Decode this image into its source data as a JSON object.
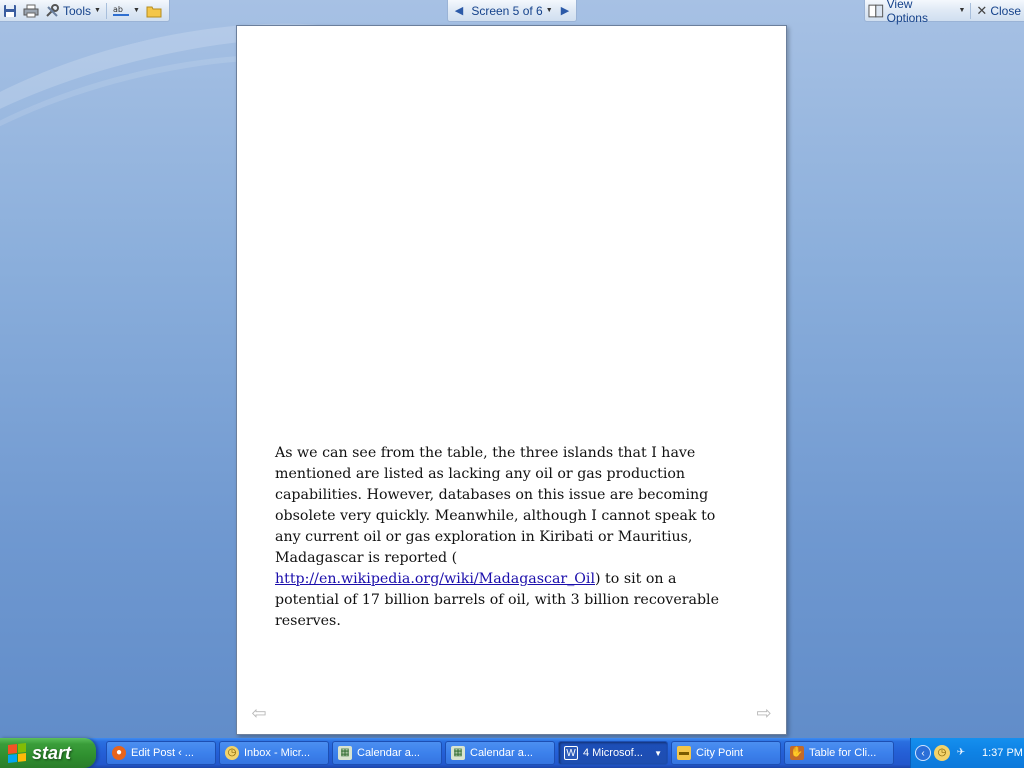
{
  "toolbar": {
    "tools_label": "Tools",
    "screen_label": "Screen 5 of 6",
    "view_options_label": "View Options",
    "close_label": "Close"
  },
  "page": {
    "paragraph_before_link": "As we can see from the table, the three islands that I have mentioned are listed as lacking any oil or gas production capabilities. However, databases on this issue are becoming obsolete very quickly. Meanwhile, although I cannot speak to any current oil or gas exploration in Kiribati or Mauritius, Madagascar is reported (",
    "link_text": "http://en.wikipedia.org/wiki/Madagascar_Oil",
    "paragraph_after_link": ") to sit on a potential of 17 billion barrels of oil, with 3 billion recoverable reserves."
  },
  "taskbar": {
    "start_label": "start",
    "tasks": [
      {
        "label": "Edit Post ‹ ...",
        "icon": "firefox-icon"
      },
      {
        "label": "Inbox - Micr...",
        "icon": "outlook-icon"
      },
      {
        "label": "Calendar a...",
        "icon": "calendar-icon"
      },
      {
        "label": "Calendar a...",
        "icon": "calendar-icon"
      },
      {
        "label": "4 Microsof...",
        "icon": "word-icon"
      },
      {
        "label": "City Point",
        "icon": "folder-icon"
      },
      {
        "label": "Table for Cli...",
        "icon": "app-icon"
      }
    ],
    "clock": "1:37 PM"
  },
  "colors": {
    "link": "#1a0dab",
    "taskbar": "#245fd6",
    "start": "#3a9d3a",
    "toolbar_text": "#15428b"
  }
}
